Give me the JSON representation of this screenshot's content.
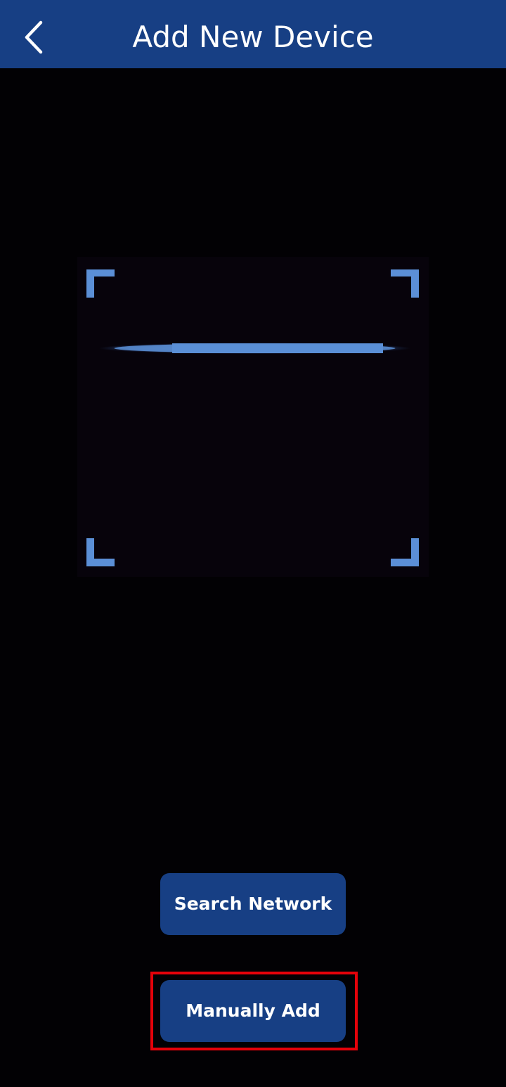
{
  "header": {
    "title": "Add New Device",
    "back_icon": "chevron-left-icon"
  },
  "scanner": {
    "corner_icon": "scan-frame-corner",
    "line_icon": "scan-line"
  },
  "actions": {
    "search_network_label": "Search Network",
    "manually_add_label": "Manually Add"
  },
  "colors": {
    "header_bg": "#173f84",
    "button_bg": "#173f84",
    "frame_accent": "#5b8fd6",
    "highlight": "#e5020a",
    "background": "#020104"
  }
}
